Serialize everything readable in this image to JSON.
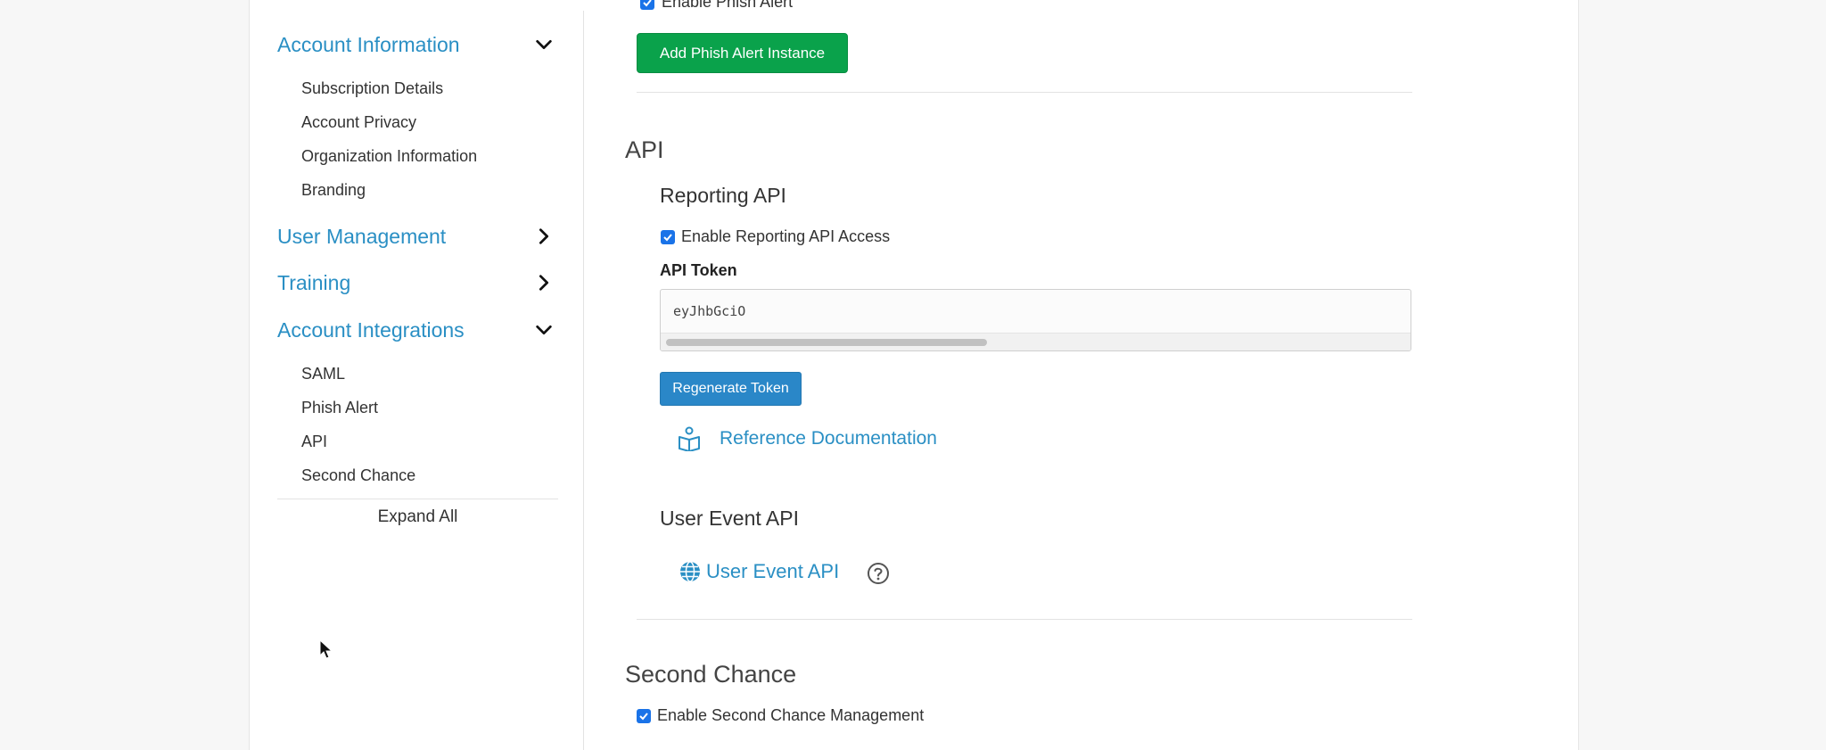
{
  "sidebar": {
    "sections": [
      {
        "label": "Account Information",
        "state": "expanded",
        "items": [
          "Subscription Details",
          "Account Privacy",
          "Organization Information",
          "Branding"
        ]
      },
      {
        "label": "User Management",
        "state": "collapsed",
        "items": []
      },
      {
        "label": "Training",
        "state": "collapsed",
        "items": []
      },
      {
        "label": "Account Integrations",
        "state": "expanded",
        "items": [
          "SAML",
          "Phish Alert",
          "API",
          "Second Chance"
        ]
      }
    ],
    "expand_all": "Expand All"
  },
  "main": {
    "top_checkbox_label": "Enable Phish Alert",
    "add_phish_alert_button": "Add Phish Alert Instance",
    "api": {
      "heading": "API",
      "reporting": {
        "heading": "Reporting API",
        "enable_label": "Enable Reporting API Access",
        "enabled": true,
        "token_label": "API Token",
        "token_value": "eyJhbGciO",
        "regenerate_button": "Regenerate Token",
        "reference_link": "Reference Documentation"
      },
      "user_event": {
        "heading": "User Event API",
        "link": "User Event API"
      }
    },
    "second_chance": {
      "heading": "Second Chance",
      "enable_label": "Enable Second Chance Management",
      "enabled": true
    }
  },
  "colors": {
    "link": "#2a8fc4",
    "green_button": "#0aa24b",
    "blue_button": "#2a87c8",
    "checkbox": "#1a73e8"
  },
  "icons": [
    "chevron-down-icon",
    "chevron-right-icon",
    "book-icon",
    "globe-icon",
    "question-circle-icon",
    "mouse-cursor-icon"
  ]
}
